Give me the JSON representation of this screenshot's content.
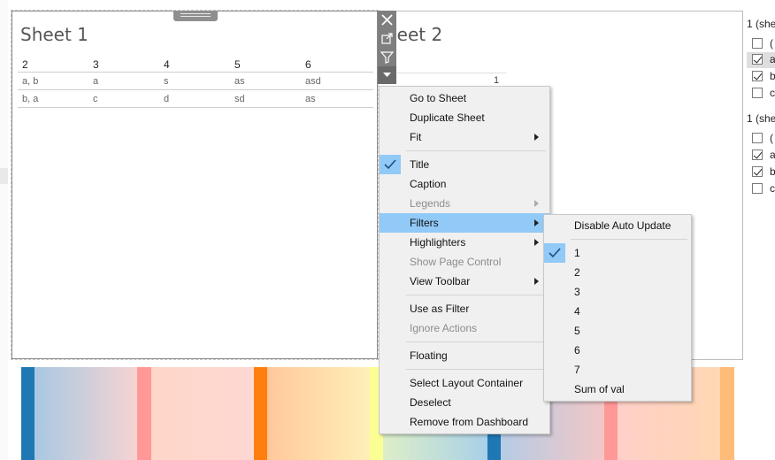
{
  "sheet1": {
    "title": "Sheet 1",
    "columns": [
      "2",
      "3",
      "4",
      "5",
      "6"
    ],
    "rows": [
      [
        "a, b",
        "a",
        "s",
        "as",
        "asd"
      ],
      [
        "b, a",
        "c",
        "d",
        "sd",
        "as"
      ]
    ]
  },
  "sheet2": {
    "title_visible": "heet 2",
    "value": "1"
  },
  "side_panel": {
    "group1_title": "1 (she",
    "group1_items": [
      {
        "label": "(",
        "checked": false
      },
      {
        "label": "a",
        "checked": true
      },
      {
        "label": "b",
        "checked": true
      },
      {
        "label": "c",
        "checked": false
      }
    ],
    "group2_title": "1 (she",
    "group2_items": [
      {
        "label": "(",
        "checked": false
      },
      {
        "label": "a",
        "checked": true
      },
      {
        "label": "b",
        "checked": true
      },
      {
        "label": "c",
        "checked": false
      }
    ]
  },
  "toolbar_icons": [
    "close-icon",
    "external-link-icon",
    "filter-icon",
    "more-options-icon"
  ],
  "context_menu": {
    "items": [
      {
        "label": "Go to Sheet"
      },
      {
        "label": "Duplicate Sheet"
      },
      {
        "label": "Fit"
      },
      {
        "label": "Title"
      },
      {
        "label": "Caption"
      },
      {
        "label": "Legends"
      },
      {
        "label": "Filters"
      },
      {
        "label": "Highlighters"
      },
      {
        "label": "Show Page Control"
      },
      {
        "label": "View Toolbar"
      },
      {
        "label": "Use as Filter"
      },
      {
        "label": "Ignore Actions"
      },
      {
        "label": "Floating"
      },
      {
        "label": "Select Layout Container"
      },
      {
        "label": "Deselect"
      },
      {
        "label": "Remove from Dashboard"
      }
    ]
  },
  "filters_submenu": {
    "items": [
      {
        "label": "Disable Auto Update"
      },
      {
        "label": "1"
      },
      {
        "label": "2"
      },
      {
        "label": "3"
      },
      {
        "label": "4"
      },
      {
        "label": "5"
      },
      {
        "label": "6"
      },
      {
        "label": "7"
      },
      {
        "label": "Sum of val"
      }
    ]
  },
  "colors": {
    "menu_highlight": "#91c9f7",
    "menu_bg": "#f0f0f0",
    "toolbar_gray": "#7f7f7f",
    "strip_blue": "#1f77b4",
    "strip_orange": "#ff7f0e",
    "strip_pink": "#ff9896",
    "strip_light_orange": "#ffbb78"
  }
}
